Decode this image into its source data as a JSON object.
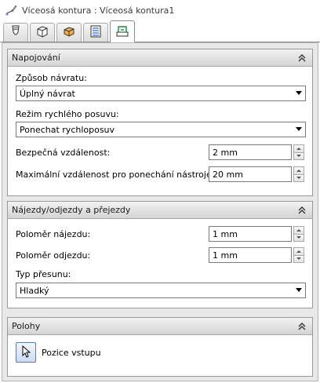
{
  "window": {
    "title": "Víceosá kontura : Víceosá kontura1",
    "title_icon": "pencil-contour-icon"
  },
  "tabs": [
    {
      "icon": "tool-icon"
    },
    {
      "icon": "cube-icon"
    },
    {
      "icon": "stock-icon"
    },
    {
      "icon": "settings-sheet-icon"
    },
    {
      "icon": "linking-icon",
      "active": true
    }
  ],
  "sections": {
    "linking": {
      "title": "Napojování",
      "return_mode_label": "Způsob návratu:",
      "return_mode_value": "Úplný návrat",
      "rapid_mode_label": "Režim rychlého posuvu:",
      "rapid_mode_value": "Ponechat rychloposuv",
      "safe_distance_label": "Bezpečná vzdálenost:",
      "safe_distance_value": "2 mm",
      "max_stay_down_label": "Maximální vzdálenost pro ponechání nástroje dole:",
      "max_stay_down_value": "20 mm"
    },
    "leads": {
      "title": "Nájezdy/odjezdy a přejezdy",
      "lead_in_radius_label": "Poloměr nájezdu:",
      "lead_in_radius_value": "1 mm",
      "lead_out_radius_label": "Poloměr odjezdu:",
      "lead_out_radius_value": "1 mm",
      "transition_label": "Typ přesunu:",
      "transition_value": "Hladký"
    },
    "positions": {
      "title": "Polohy",
      "entry_label": "Pozice vstupu"
    }
  }
}
